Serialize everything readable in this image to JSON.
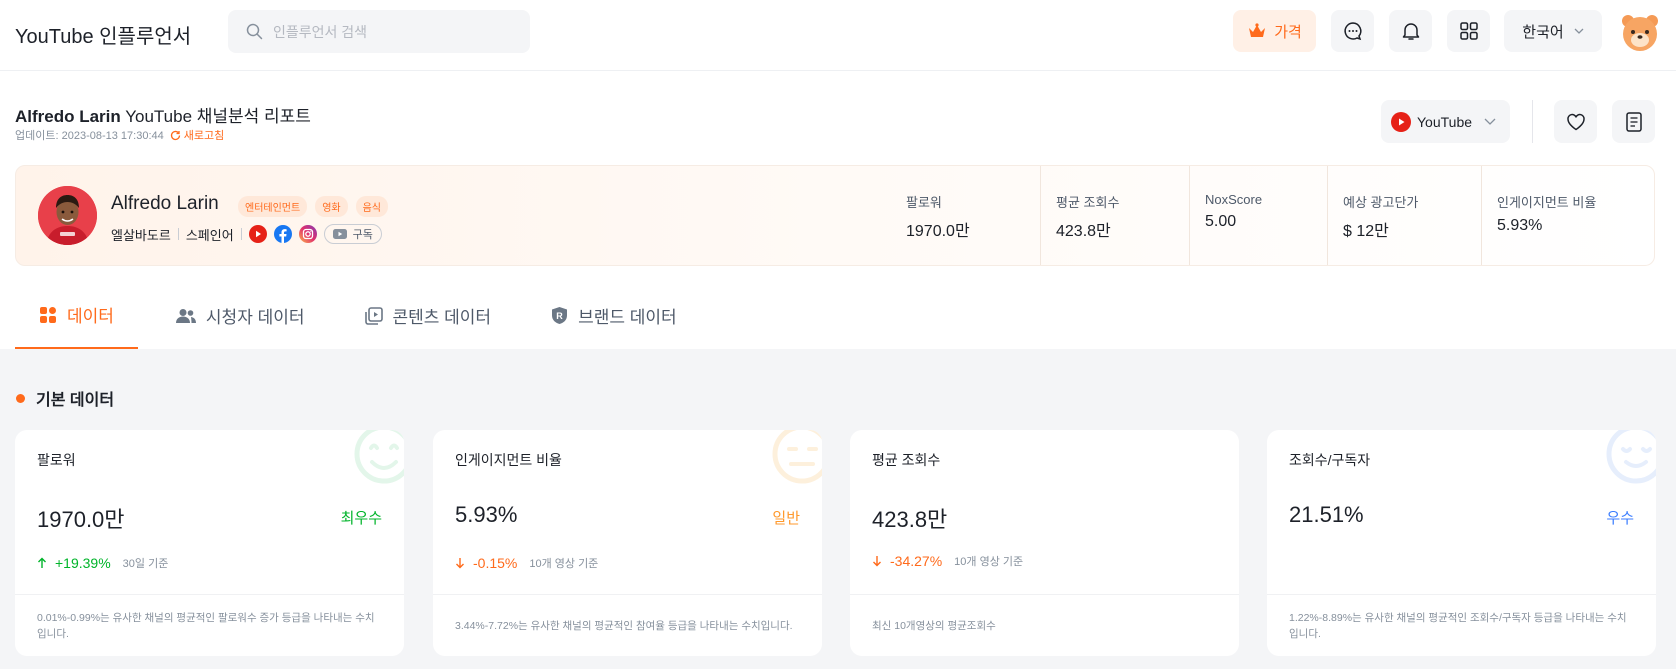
{
  "header": {
    "brand": "YouTube 인플루언서",
    "search_placeholder": "인플루언서 검색",
    "price_label": "가격",
    "language": "한국어"
  },
  "report": {
    "name": "Alfredo Larin",
    "title_suffix": "YouTube 채널분석 리포트",
    "updated": "업데이트: 2023-08-13 17:30:44",
    "refresh": "새로고침",
    "platform": "YouTube"
  },
  "profile": {
    "name": "Alfredo Larin",
    "tags": [
      "엔터테인먼트",
      "영화",
      "음식"
    ],
    "country": "엘살바도르",
    "language": "스페인어",
    "subscribe": "구독",
    "stats": [
      {
        "label": "팔로워",
        "value": "1970.0만"
      },
      {
        "label": "평균 조회수",
        "value": "423.8만"
      },
      {
        "label": "NoxScore",
        "value": "5.00"
      },
      {
        "label": "예상 광고단가",
        "value": "$ 12만"
      },
      {
        "label": "인게이지먼트 비율",
        "value": "5.93%"
      }
    ]
  },
  "tabs": [
    {
      "label": "데이터"
    },
    {
      "label": "시청자 데이터"
    },
    {
      "label": "콘텐츠 데이터"
    },
    {
      "label": "브랜드 데이터"
    }
  ],
  "section": {
    "title": "기본 데이터"
  },
  "cards": [
    {
      "label": "팔로워",
      "value": "1970.0만",
      "grade": "최우수",
      "grade_color": "#00b42a",
      "change": "+19.39%",
      "basis": "30일 기준",
      "note": "0.01%-0.99%는 유사한 채널의 평균적인 팔로워수 증가 등급을 나타내는 수치입니다."
    },
    {
      "label": "인게이지먼트 비율",
      "value": "5.93%",
      "grade": "일반",
      "grade_color": "#ff9a2e",
      "change": "-0.15%",
      "basis": "10개 영상 기준",
      "note": "3.44%-7.72%는 유사한 채널의 평균적인 참여율 등급을 나타내는 수치입니다."
    },
    {
      "label": "평균 조회수",
      "value": "423.8만",
      "grade": "",
      "change": "-34.27%",
      "basis": "10개 영상 기준",
      "note": "최신 10개영상의 평균조회수"
    },
    {
      "label": "조회수/구독자",
      "value": "21.51%",
      "grade": "우수",
      "grade_color": "#3c7eff",
      "change": "",
      "basis": "",
      "note": "1.22%-8.89%는 유사한 채널의 평균적인 조회수/구독자 등급을 나타내는 수치입니다."
    }
  ]
}
